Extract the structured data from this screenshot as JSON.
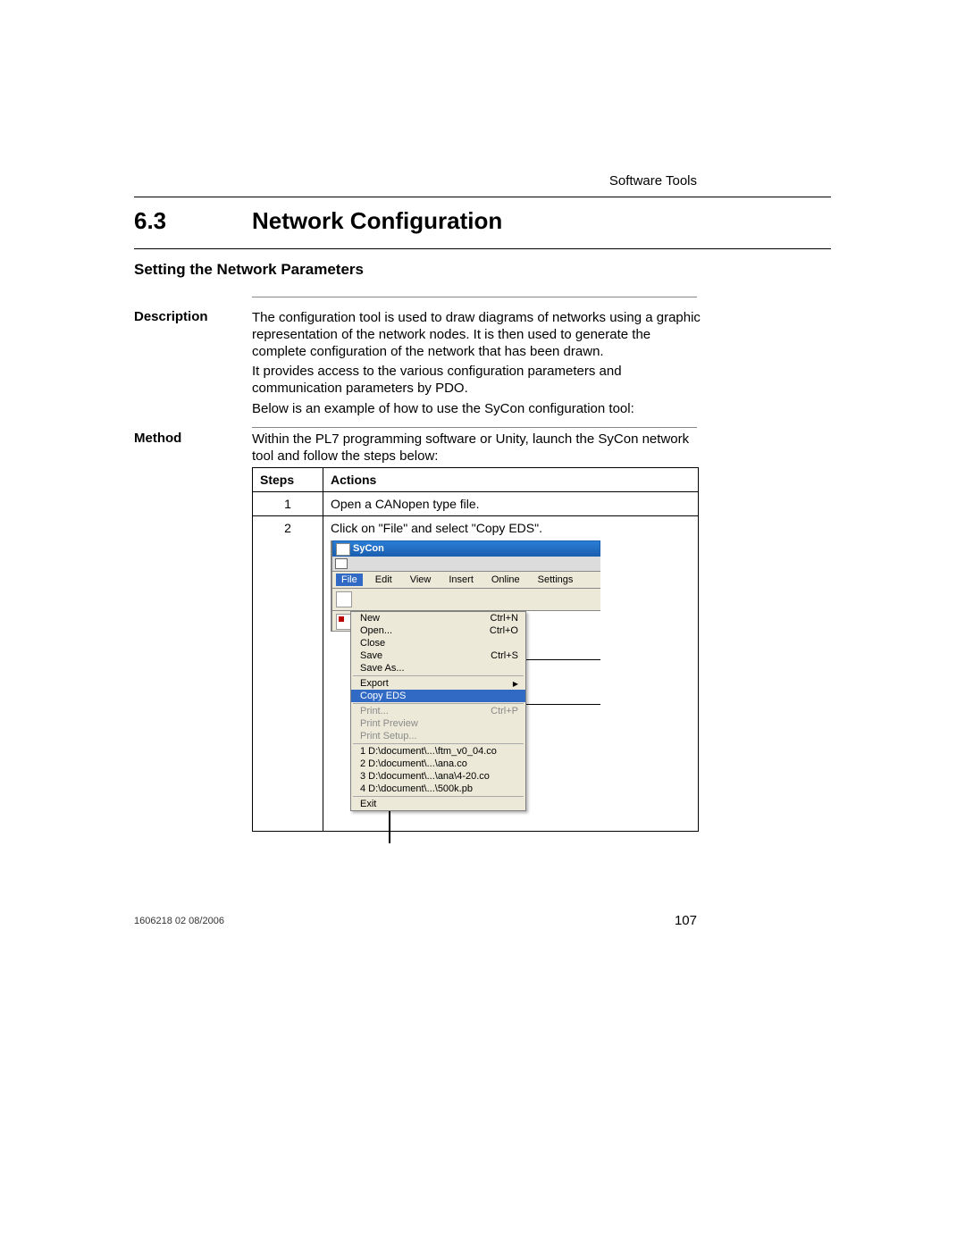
{
  "header": {
    "section": "Software Tools"
  },
  "section": {
    "number": "6.3",
    "title": "Network Configuration"
  },
  "subsection": {
    "title": "Setting the Network Parameters"
  },
  "description": {
    "label": "Description",
    "p1": "The configuration tool is used to draw diagrams of networks using a graphic representation of the network nodes. It is then used to generate the complete configuration of the network that has been drawn.",
    "p2": "It provides access to the various configuration parameters and communication parameters by PDO.",
    "p3": "Below is an example of how to use the SyCon configuration tool:"
  },
  "method": {
    "label": "Method",
    "p1": "Within the PL7 programming software or Unity, launch the SyCon network tool and follow the steps below:"
  },
  "table": {
    "head_steps": "Steps",
    "head_actions": "Actions",
    "row1_step": "1",
    "row1_action": "Open a CANopen type file.",
    "row2_step": "2",
    "row2_action": "Click on \"File\" and select \"Copy EDS\"."
  },
  "sycon": {
    "title": "SyCon",
    "menubar": {
      "file": "File",
      "edit": "Edit",
      "view": "View",
      "insert": "Insert",
      "online": "Online",
      "settings": "Settings"
    },
    "menu": {
      "new": "New",
      "new_sc": "Ctrl+N",
      "open": "Open...",
      "open_sc": "Ctrl+O",
      "close": "Close",
      "save": "Save",
      "save_sc": "Ctrl+S",
      "saveas": "Save As...",
      "export": "Export",
      "copyeds": "Copy EDS",
      "print": "Print...",
      "print_sc": "Ctrl+P",
      "preview": "Print Preview",
      "setup": "Print Setup...",
      "r1": "1 D:\\document\\...\\ftm_v0_04.co",
      "r2": "2 D:\\document\\...\\ana.co",
      "r3": "3 D:\\document\\...\\ana\\4-20.co",
      "r4": "4 D:\\document\\...\\500k.pb",
      "exit": "Exit"
    }
  },
  "footer": {
    "left": "1606218 02 08/2006",
    "page": "107"
  }
}
